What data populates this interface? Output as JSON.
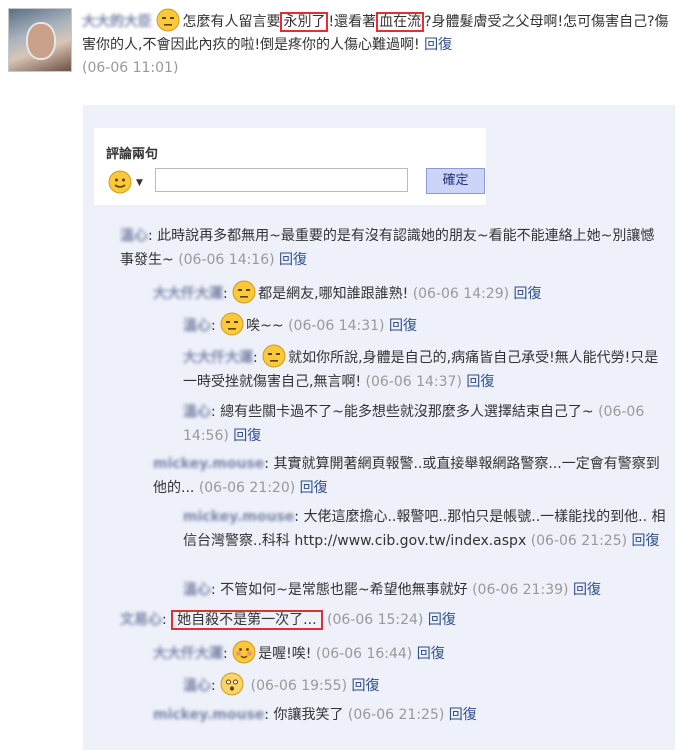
{
  "post": {
    "author": "大大的大臣",
    "text_1": "怎麼有人留言要",
    "hl_1": "永別了",
    "text_2": "!還看著",
    "hl_2": "血在流",
    "text_3": "?身體髮膚受之父母啊!怎可傷害自己?傷害你的人,不會因此內疚的啦!倒是疼你的人傷心難過啊!",
    "reply": "回復",
    "timestamp": "(06-06 11:01)"
  },
  "form": {
    "title": "評論兩句",
    "input_value": "",
    "confirm_label": "確定"
  },
  "comments": [
    {
      "author": "溫心",
      "text": ": 此時說再多都無用~最重要的是有沒有認識她的朋友~看能不能連絡上她~別讓憾事發生~",
      "ts": "(06-06 14:16)",
      "reply": "回復"
    },
    {
      "author": "大大仟大運",
      "text": "都是網友,哪知誰跟誰熟!",
      "ts": "(06-06 14:29)",
      "reply": "回復"
    },
    {
      "author": "溫心",
      "text": "唉~~",
      "ts": "(06-06 14:31)",
      "reply": "回復"
    },
    {
      "author": "大大仟大運",
      "text": "就如你所說,身體是自己的,病痛皆自己承受!無人能代勞!只是一時受挫就傷害自己,無言啊!",
      "ts": "(06-06 14:37)",
      "reply": "回復"
    },
    {
      "author": "溫心",
      "text": ": 總有些關卡過不了~能多想些就沒那麼多人選擇結束自己了~",
      "ts": "(06-06 14:56)",
      "reply": "回復"
    },
    {
      "author": "mickey.mouse",
      "text": ": 其實就算開著網頁報警..或直接舉報網路警察...一定會有警察到他的...",
      "ts": "(06-06 21:20)",
      "reply": "回復"
    },
    {
      "author": "mickey.mouse",
      "text": ": 大佬這麼擔心..報警吧..那怕只是帳號..一樣能找的到他.. 相信台灣警察..科科 http://www.cib.gov.tw/index.aspx",
      "ts": "(06-06 21:25)",
      "reply": "回復"
    },
    {
      "author": "溫心",
      "text": ": 不管如何~是常態也罷~希望他無事就好",
      "ts": "(06-06 21:39)",
      "reply": "回復"
    },
    {
      "author": "文易心",
      "text": "她自殺不是第一次了...",
      "ts": "(06-06 15:24)",
      "reply": "回復"
    },
    {
      "author": "大大仟大運",
      "text": "是喔!唉!",
      "ts": "(06-06 16:44)",
      "reply": "回復"
    },
    {
      "author": "溫心",
      "text": "",
      "ts": "(06-06 19:55)",
      "reply": "回復"
    },
    {
      "author": "mickey.mouse",
      "text": ": 你讓我笑了",
      "ts": "(06-06 21:25)",
      "reply": "回復"
    }
  ],
  "colors": {
    "panel": "#eff1fa",
    "link": "#2e4f8a",
    "timestamp": "#999999",
    "highlight": "#e03030"
  }
}
